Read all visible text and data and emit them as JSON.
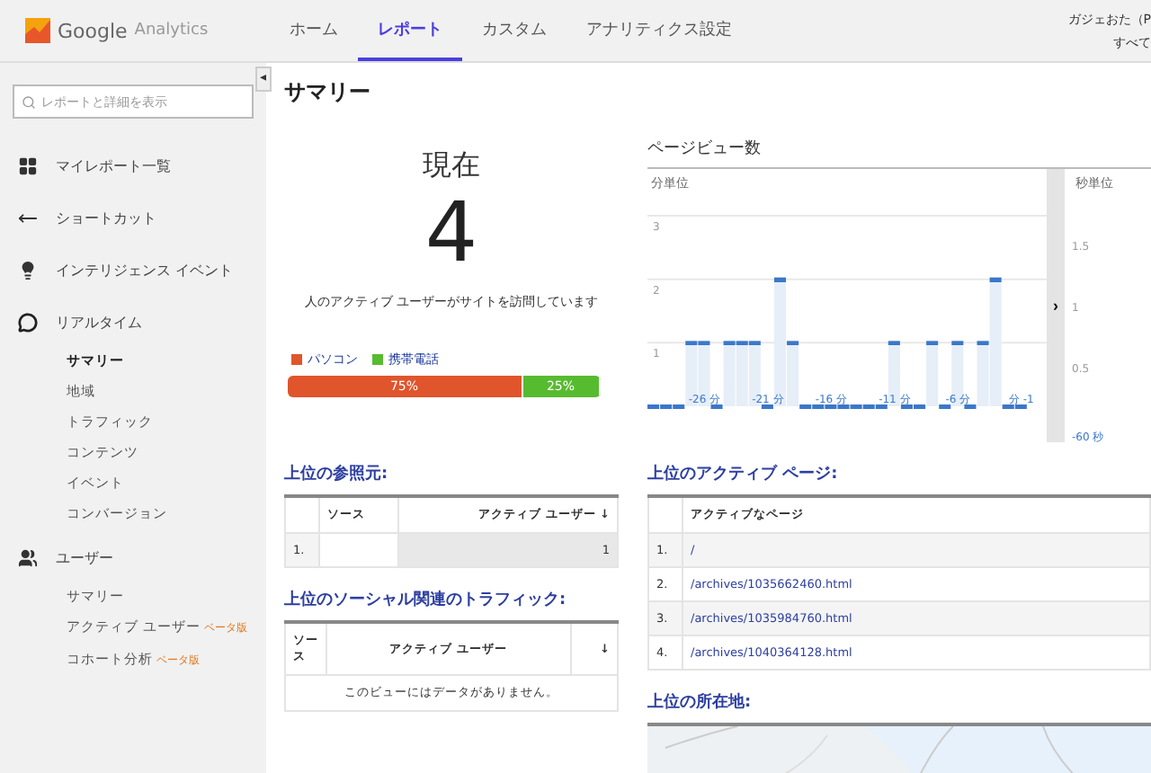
{
  "header": {
    "logo_text": "Google",
    "logo_sub": "Analytics",
    "nav": [
      {
        "label": "ホーム",
        "selected": false
      },
      {
        "label": "レポート",
        "selected": true
      },
      {
        "label": "カスタム",
        "selected": false
      },
      {
        "label": "アナリティクス設定",
        "selected": false
      }
    ],
    "account_line1": "ガジェおた（P",
    "account_line2": "すべて"
  },
  "sidebar": {
    "search": {
      "placeholder": "レポートと詳細を表示"
    },
    "collapse": "◂",
    "sections": [
      {
        "kind": "grid",
        "label": "マイレポート一覧"
      },
      {
        "kind": "shortcut",
        "label": "ショートカット"
      },
      {
        "kind": "bulb",
        "label": "インテリジェンス イベント"
      },
      {
        "kind": "realtime",
        "label": "リアルタイム",
        "children": [
          {
            "label": "サマリー",
            "selected": true
          },
          {
            "label": "地域",
            "selected": false
          },
          {
            "label": "トラフィック",
            "selected": false
          },
          {
            "label": "コンテンツ",
            "selected": false
          },
          {
            "label": "イベント",
            "selected": false
          },
          {
            "label": "コンバージョン",
            "selected": false
          }
        ]
      },
      {
        "kind": "users",
        "label": "ユーザー",
        "children": [
          {
            "label": "サマリー",
            "selected": false
          },
          {
            "label": "アクティブ ユーザー",
            "badge": "ベータ版",
            "selected": false
          },
          {
            "label": "コホート分析",
            "badge": "ベータ版",
            "selected": false
          }
        ]
      }
    ]
  },
  "page_title": "サマリー",
  "now": {
    "heading": "現在",
    "count": "4",
    "caption": "人のアクティブ ユーザーがサイトを訪問しています",
    "devices": [
      {
        "label": "パソコン",
        "color": "#e0552b",
        "level": 0.75,
        "reading": "75%"
      },
      {
        "label": "携帯電話",
        "color": "#57bb2f",
        "level": 0.25,
        "reading": "25%"
      }
    ]
  },
  "pageviews": {
    "title": "ページビュー数",
    "minute_panel": {
      "title": "分単位",
      "chart_data": {
        "type": "bar",
        "x": [
          -30,
          -29,
          -28,
          -27,
          -26,
          -25,
          -24,
          -23,
          -22,
          -21,
          -20,
          -19,
          -18,
          -17,
          -16,
          -15,
          -14,
          -13,
          -12,
          -11,
          -10,
          -9,
          -8,
          -7,
          -6,
          -5,
          -4,
          -3,
          -2,
          -1
        ],
        "values": [
          0,
          0,
          0,
          1,
          1,
          0,
          1,
          1,
          1,
          0,
          2,
          1,
          0,
          0,
          0,
          0,
          0,
          0,
          0,
          1,
          0,
          0,
          1,
          0,
          1,
          0,
          1,
          2,
          0,
          0
        ],
        "xlim": [
          -30.5,
          1
        ],
        "ylim": [
          0,
          3
        ],
        "yticks": [
          1,
          2,
          3
        ],
        "xticks": [
          {
            "value": -26,
            "label": "-26 分"
          },
          {
            "value": -21,
            "label": "-21 分"
          },
          {
            "value": -16,
            "label": "-16 分"
          },
          {
            "value": -11,
            "label": "-11 分"
          },
          {
            "value": -6,
            "label": "-6 分"
          },
          {
            "value": -1,
            "label": "分 -1"
          }
        ]
      }
    },
    "toggle": "›",
    "second_panel": {
      "title": "秒単位",
      "ticks": [
        "1.5",
        "1",
        "0.5"
      ],
      "x_label": "-60 秒"
    }
  },
  "referrers": {
    "title": "上位の参照元:",
    "columns": [
      "ソース",
      "アクティブ ユーザー ↓"
    ],
    "rows": [
      {
        "index": "1.",
        "users": "1"
      }
    ]
  },
  "social": {
    "title": "上位のソーシャル関連のトラフィック:",
    "columns": [
      "ソース",
      "アクティブ ユーザー",
      "↓"
    ],
    "empty": "このビューにはデータがありません。"
  },
  "active_pages": {
    "title": "上位のアクティブ ページ:",
    "column": "アクティブなページ",
    "rows": [
      {
        "index": "1.",
        "page": "/"
      },
      {
        "index": "2.",
        "page": "/archives/1035662460.html"
      },
      {
        "index": "3.",
        "page": "/archives/1035984760.html"
      },
      {
        "index": "4.",
        "page": "/archives/1040364128.html"
      }
    ]
  },
  "locations": {
    "title": "上位の所在地:"
  }
}
